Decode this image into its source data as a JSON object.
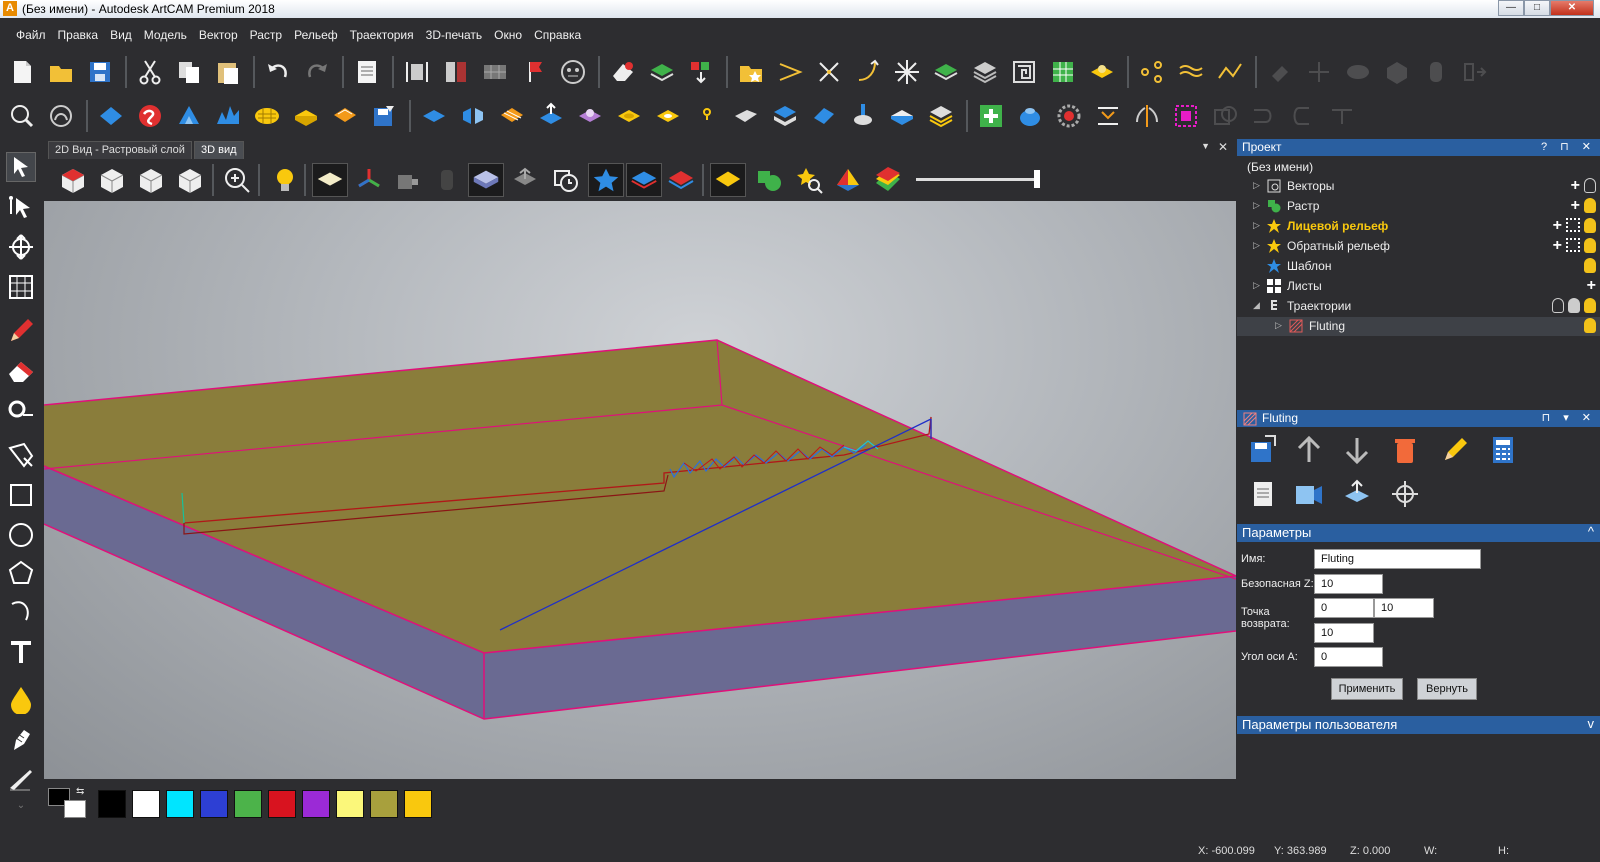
{
  "window": {
    "title": "(Без имени) - Autodesk ArtCAM Premium 2018",
    "logo_letter": "A",
    "buttons": {
      "minimize": "—",
      "maximize": "□",
      "close": "✕"
    }
  },
  "menu": [
    "Файл",
    "Правка",
    "Вид",
    "Модель",
    "Вектор",
    "Растр",
    "Рельеф",
    "Траектория",
    "3D-печать",
    "Окно",
    "Справка"
  ],
  "view_tabs": [
    {
      "label": "2D Вид - Растровый слой",
      "active": false
    },
    {
      "label": "3D вид",
      "active": true
    }
  ],
  "view_tab_controls": {
    "dropdown": "▼",
    "close": "✕"
  },
  "project_panel": {
    "title": "Проект",
    "controls": "? ⊓ ✕",
    "root": "(Без имени)",
    "items": [
      {
        "label": "Векторы",
        "icon": "vectors-icon",
        "bold": false
      },
      {
        "label": "Растр",
        "icon": "raster-icon",
        "bold": false
      },
      {
        "label": "Лицевой рельеф",
        "icon": "star-icon",
        "bold": true
      },
      {
        "label": "Обратный рельеф",
        "icon": "star-icon",
        "bold": false
      },
      {
        "label": "Шаблон",
        "icon": "star-blue-icon",
        "bold": false
      },
      {
        "label": "Листы",
        "icon": "sheets-icon",
        "bold": false
      },
      {
        "label": "Траектории",
        "icon": "toolpaths-icon",
        "bold": false
      },
      {
        "label": "Fluting",
        "icon": "fluting-icon",
        "bold": false
      }
    ]
  },
  "fluting_panel": {
    "title": "Fluting",
    "controls": "⊓ ▾ ✕"
  },
  "params": {
    "section_title": "Параметры",
    "name_label": "Имя:",
    "name_value": "Fluting",
    "safe_z_label": "Безопасная Z:",
    "safe_z_value": "10",
    "home_label_line1": "Точка",
    "home_label_line2": "возврата:",
    "home_x": "0",
    "home_y": "10",
    "home_z": "10",
    "a_axis_label": "Угол оси A:",
    "a_axis_value": "0",
    "apply_label": "Применить",
    "revert_label": "Вернуть",
    "user_section_title": "Параметры пользователя",
    "collapse_glyph": "^",
    "expand_glyph": "v"
  },
  "palette": {
    "colors": [
      "#000000",
      "#ffffff",
      "#00e5ff",
      "#2d3fd4",
      "#4cb34a",
      "#d8131f",
      "#9b2ad6",
      "#fbf77a",
      "#a8a03d",
      "#f9c80e"
    ]
  },
  "status": {
    "x": "X: -600.099",
    "y": "Y: 363.989",
    "z": "Z: 0.000",
    "w": "W:",
    "h": "H:"
  },
  "colors": {
    "accent_panel": "#2a5fa0",
    "toolbar_bg": "#2d2d30",
    "model_top": "#8a7d3b",
    "model_side": "#6d6d94",
    "edge_magenta": "#e0107a"
  }
}
